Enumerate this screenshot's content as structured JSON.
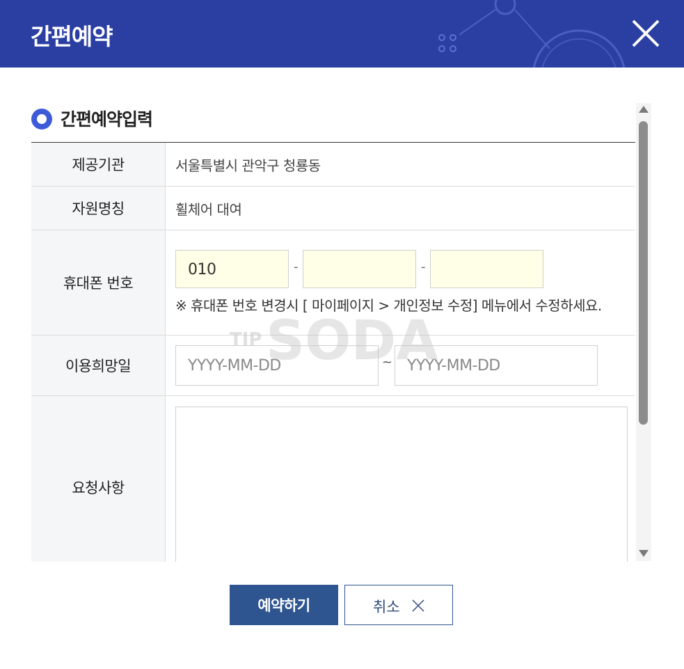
{
  "header": {
    "title": "간편예약",
    "bg_color": "#2b3fa3"
  },
  "section": {
    "title": "간편예약입력",
    "icon": "radio-bullet-icon"
  },
  "form": {
    "provider_label": "제공기관",
    "provider_value": "서울특별시 관악구 청룡동",
    "resource_label": "자원명칭",
    "resource_value": "휠체어 대여",
    "phone_label": "휴대폰 번호",
    "phone_part1": "010",
    "phone_part2": "",
    "phone_part3": "",
    "phone_dash": "-",
    "phone_note": "※ 휴대폰 번호 변경시 [ 마이페이지 > 개인정보 수정] 메뉴에서 수정하세요.",
    "date_label": "이용희망일",
    "date_start_placeholder": "YYYY-MM-DD",
    "date_end_placeholder": "YYYY-MM-DD",
    "date_separator": "~",
    "request_label": "요청사항",
    "request_value": ""
  },
  "watermark": {
    "text": "SODA",
    "prefix": "TIP"
  },
  "buttons": {
    "submit_label": "예약하기",
    "cancel_label": "취소",
    "submit_color": "#2e5590"
  }
}
